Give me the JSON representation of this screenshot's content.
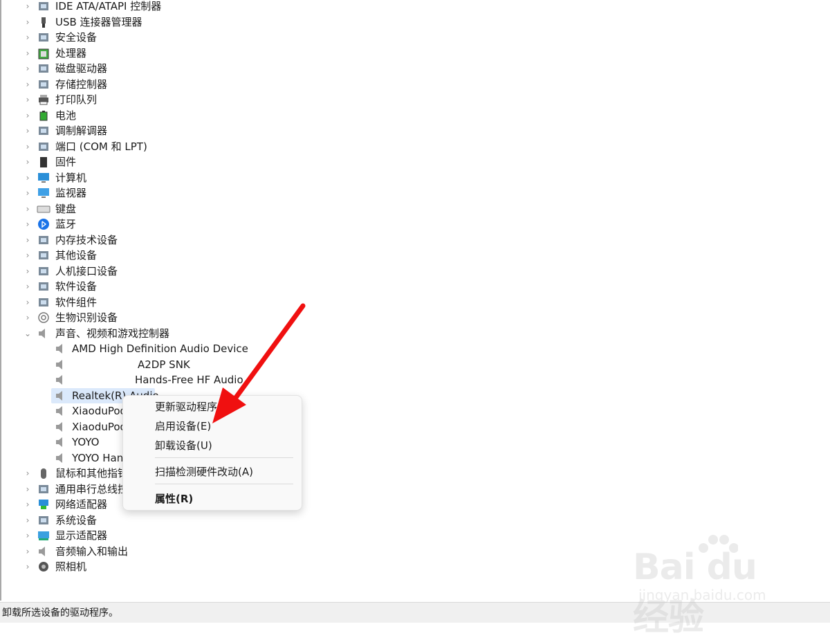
{
  "categories_top": [
    {
      "label": "IDE ATA/ATAPI 控制器",
      "icon": "ide-controller-icon"
    },
    {
      "label": "USB 连接器管理器",
      "icon": "usb-icon"
    },
    {
      "label": "安全设备",
      "icon": "security-device-icon"
    },
    {
      "label": "处理器",
      "icon": "processor-icon"
    },
    {
      "label": "磁盘驱动器",
      "icon": "disk-drive-icon"
    },
    {
      "label": "存储控制器",
      "icon": "storage-controller-icon"
    },
    {
      "label": "打印队列",
      "icon": "printer-icon"
    },
    {
      "label": "电池",
      "icon": "battery-icon"
    },
    {
      "label": "调制解调器",
      "icon": "modem-icon"
    },
    {
      "label": "端口 (COM 和 LPT)",
      "icon": "port-icon"
    },
    {
      "label": "固件",
      "icon": "firmware-icon"
    },
    {
      "label": "计算机",
      "icon": "computer-icon"
    },
    {
      "label": "监视器",
      "icon": "monitor-icon"
    },
    {
      "label": "键盘",
      "icon": "keyboard-icon"
    },
    {
      "label": "蓝牙",
      "icon": "bluetooth-icon"
    },
    {
      "label": "内存技术设备",
      "icon": "memory-device-icon"
    },
    {
      "label": "其他设备",
      "icon": "other-device-icon"
    },
    {
      "label": "人机接口设备",
      "icon": "hid-icon"
    },
    {
      "label": "软件设备",
      "icon": "software-device-icon"
    },
    {
      "label": "软件组件",
      "icon": "software-component-icon"
    },
    {
      "label": "生物识别设备",
      "icon": "biometric-icon"
    }
  ],
  "expanded_category": {
    "label": "声音、视频和游戏控制器",
    "icon": "speaker-icon"
  },
  "audio_devices": [
    {
      "label": "AMD High Definition Audio Device"
    },
    {
      "label": "A2DP SNK"
    },
    {
      "label": "Hands-Free HF Audio"
    },
    {
      "label": "Realtek(R) Audio"
    },
    {
      "label": "XiaoduPod"
    },
    {
      "label": "XiaoduPod"
    },
    {
      "label": "YOYO"
    },
    {
      "label": "YOYO Han"
    }
  ],
  "categories_bottom": [
    {
      "label": "鼠标和其他指针",
      "icon": "mouse-icon"
    },
    {
      "label": "通用串行总线控",
      "icon": "usb-controller-icon"
    },
    {
      "label": "网络适配器",
      "icon": "network-adapter-icon"
    },
    {
      "label": "系统设备",
      "icon": "system-device-icon"
    },
    {
      "label": "显示适配器",
      "icon": "display-adapter-icon"
    },
    {
      "label": "音频输入和输出",
      "icon": "audio-io-icon"
    },
    {
      "label": "照相机",
      "icon": "camera-icon"
    }
  ],
  "context_menu": {
    "update_driver": "更新驱动程序",
    "enable_device": "启用设备(E)",
    "uninstall_device": "卸载设备(U)",
    "scan_hardware": "扫描检测硬件改动(A)",
    "properties": "属性(R)"
  },
  "status_bar": {
    "text": "卸载所选设备的驱动程序。"
  },
  "watermark": {
    "brand": "Bai du 经验",
    "url": "jingyan.baidu.com"
  },
  "colors": {
    "selection": "#dbe9fb",
    "arrow": "#f01010",
    "status_bg": "#f0f0f0"
  }
}
